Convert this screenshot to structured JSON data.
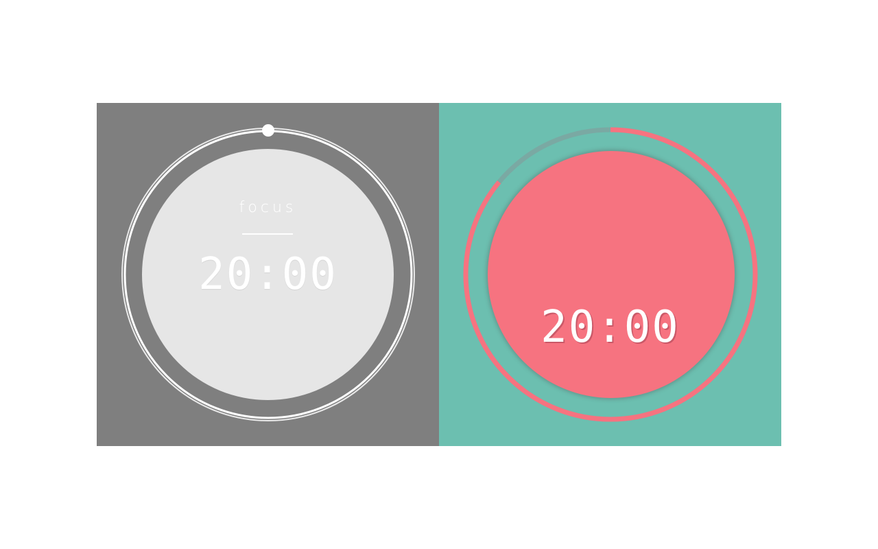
{
  "focus_panel": {
    "label": "focus",
    "time": "20:00",
    "background_color": "#7f7f7f",
    "face_color": "#e6e6e6"
  },
  "timer_panel": {
    "time": "20:00",
    "background_color": "#6cbfb0",
    "face_color": "#f67380",
    "progress_color": "#f67380",
    "track_color": "#7aa9a3",
    "remaining_fraction": 0.86
  },
  "icons": {
    "knob": "slider-handle-icon"
  }
}
